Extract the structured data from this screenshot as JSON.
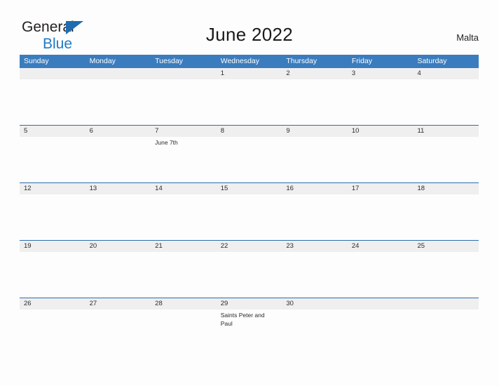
{
  "brand": {
    "name_part1": "General",
    "name_part2": "Blue",
    "flag_icon": "triangle-flag-icon",
    "accent_color": "#1f7ac4"
  },
  "header": {
    "title": "June 2022",
    "locale": "Malta"
  },
  "calendar": {
    "header_bg_color": "#3a7cbe",
    "date_band_color": "#efefef",
    "divider_color": "#2a6ead",
    "weekdays": [
      "Sunday",
      "Monday",
      "Tuesday",
      "Wednesday",
      "Thursday",
      "Friday",
      "Saturday"
    ],
    "weeks": [
      {
        "days": [
          {
            "date": "",
            "event": ""
          },
          {
            "date": "",
            "event": ""
          },
          {
            "date": "",
            "event": ""
          },
          {
            "date": "1",
            "event": ""
          },
          {
            "date": "2",
            "event": ""
          },
          {
            "date": "3",
            "event": ""
          },
          {
            "date": "4",
            "event": ""
          }
        ]
      },
      {
        "days": [
          {
            "date": "5",
            "event": ""
          },
          {
            "date": "6",
            "event": ""
          },
          {
            "date": "7",
            "event": "June 7th"
          },
          {
            "date": "8",
            "event": ""
          },
          {
            "date": "9",
            "event": ""
          },
          {
            "date": "10",
            "event": ""
          },
          {
            "date": "11",
            "event": ""
          }
        ]
      },
      {
        "days": [
          {
            "date": "12",
            "event": ""
          },
          {
            "date": "13",
            "event": ""
          },
          {
            "date": "14",
            "event": ""
          },
          {
            "date": "15",
            "event": ""
          },
          {
            "date": "16",
            "event": ""
          },
          {
            "date": "17",
            "event": ""
          },
          {
            "date": "18",
            "event": ""
          }
        ]
      },
      {
        "days": [
          {
            "date": "19",
            "event": ""
          },
          {
            "date": "20",
            "event": ""
          },
          {
            "date": "21",
            "event": ""
          },
          {
            "date": "22",
            "event": ""
          },
          {
            "date": "23",
            "event": ""
          },
          {
            "date": "24",
            "event": ""
          },
          {
            "date": "25",
            "event": ""
          }
        ]
      },
      {
        "days": [
          {
            "date": "26",
            "event": ""
          },
          {
            "date": "27",
            "event": ""
          },
          {
            "date": "28",
            "event": ""
          },
          {
            "date": "29",
            "event": "Saints Peter and Paul"
          },
          {
            "date": "30",
            "event": ""
          },
          {
            "date": "",
            "event": ""
          },
          {
            "date": "",
            "event": ""
          }
        ]
      }
    ]
  }
}
